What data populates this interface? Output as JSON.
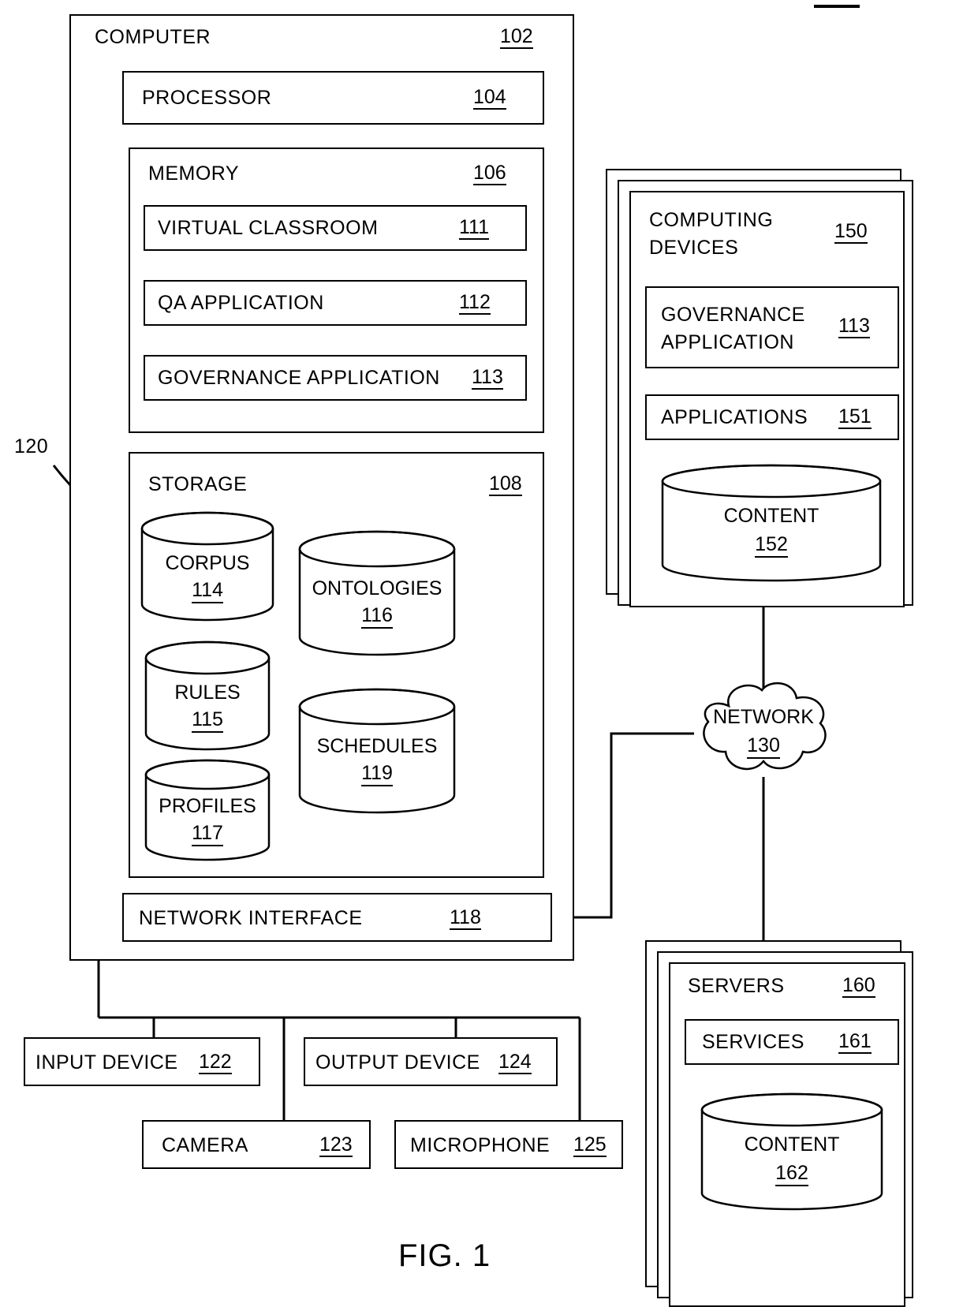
{
  "figure": {
    "caption": "FIG. 1",
    "bus_ref": "120"
  },
  "computer": {
    "title": "COMPUTER",
    "ref": "102",
    "processor": {
      "title": "PROCESSOR",
      "ref": "104"
    },
    "memory": {
      "title": "MEMORY",
      "ref": "106",
      "items": [
        {
          "title": "VIRTUAL CLASSROOM",
          "ref": "111"
        },
        {
          "title": "QA  APPLICATION",
          "ref": "112"
        },
        {
          "title": "GOVERNANCE  APPLICATION",
          "ref": "113"
        }
      ]
    },
    "storage": {
      "title": "STORAGE",
      "ref": "108",
      "cylinders": [
        {
          "title": "CORPUS",
          "ref": "114"
        },
        {
          "title": "RULES",
          "ref": "115"
        },
        {
          "title": "PROFILES",
          "ref": "117"
        },
        {
          "title": "ONTOLOGIES",
          "ref": "116"
        },
        {
          "title": "SCHEDULES",
          "ref": "119"
        }
      ]
    },
    "network_interface": {
      "title": "NETWORK INTERFACE",
      "ref": "118"
    }
  },
  "peripherals": [
    {
      "title": "INPUT DEVICE",
      "ref": "122"
    },
    {
      "title": "OUTPUT DEVICE",
      "ref": "124"
    },
    {
      "title": "CAMERA",
      "ref": "123"
    },
    {
      "title": "MICROPHONE",
      "ref": "125"
    }
  ],
  "computing_devices": {
    "title_line1": "COMPUTING",
    "title_line2": "DEVICES",
    "ref": "150",
    "governance": {
      "line1": "GOVERNANCE",
      "line2": "APPLICATION",
      "ref": "113"
    },
    "applications": {
      "title": "APPLICATIONS",
      "ref": "151"
    },
    "content": {
      "title": "CONTENT",
      "ref": "152"
    }
  },
  "network": {
    "title": "NETWORK",
    "ref": "130"
  },
  "servers": {
    "title": "SERVERS",
    "ref": "160",
    "services": {
      "title": "SERVICES",
      "ref": "161"
    },
    "content": {
      "title": "CONTENT",
      "ref": "162"
    }
  }
}
